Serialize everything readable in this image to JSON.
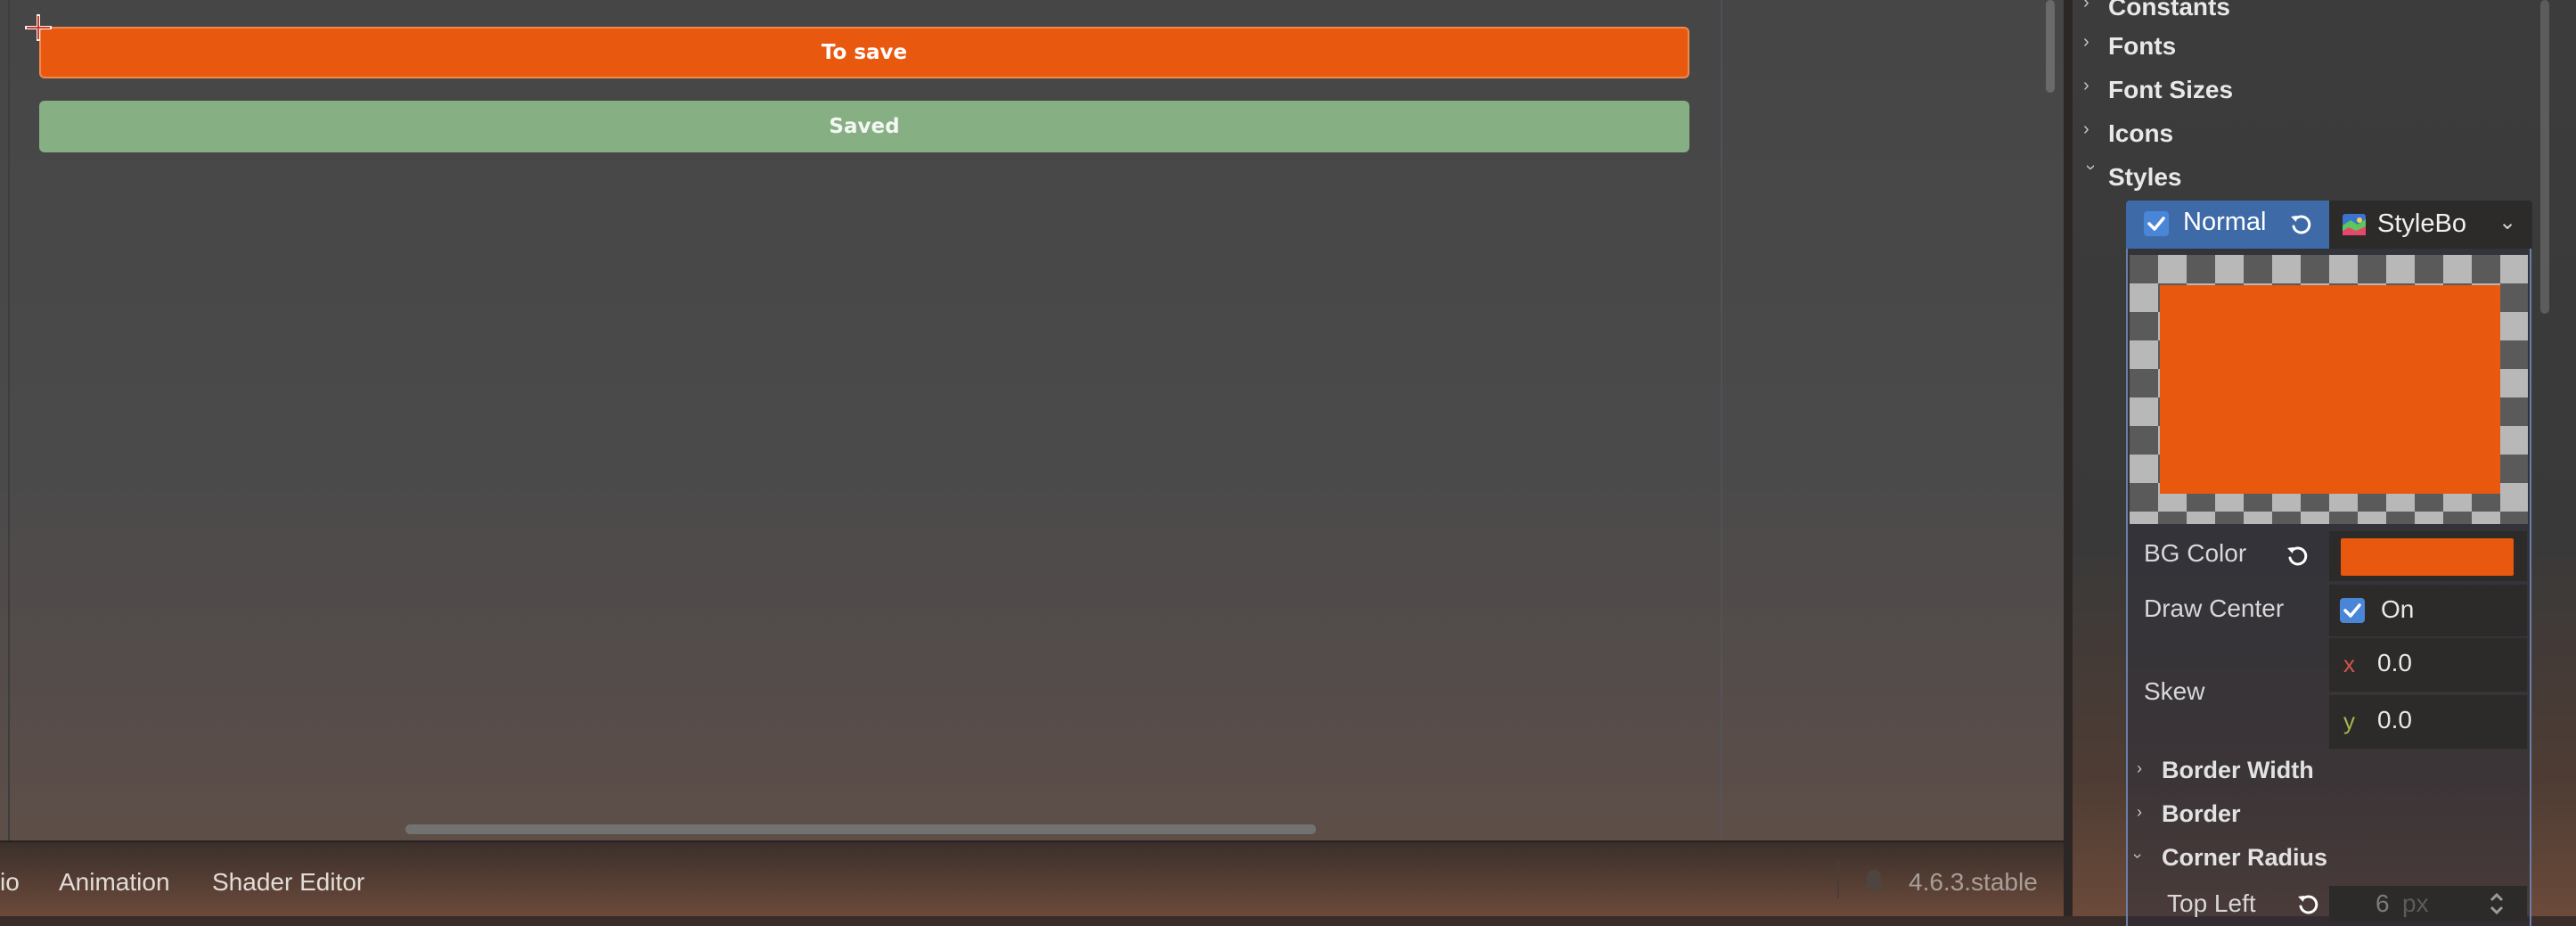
{
  "viewport": {
    "buttons": [
      {
        "label": "To save",
        "color": "#e8580f"
      },
      {
        "label": "Saved",
        "color": "#86b083"
      }
    ]
  },
  "bottom_bar": {
    "tabs": [
      "io",
      "Animation",
      "Shader Editor"
    ],
    "version": "4.6.3.stable",
    "notification_icon": "bell-icon"
  },
  "inspector": {
    "categories": [
      {
        "label": "Constants",
        "expanded": false
      },
      {
        "label": "Fonts",
        "expanded": false
      },
      {
        "label": "Font Sizes",
        "expanded": false
      },
      {
        "label": "Icons",
        "expanded": false
      },
      {
        "label": "Styles",
        "expanded": true
      }
    ],
    "normal": {
      "label": "Normal",
      "checked": true,
      "resource_type": "StyleBo",
      "resource_icon": "stylebox-icon"
    },
    "stylebox": {
      "preview_color": "#e8580f",
      "bg_color_label": "BG Color",
      "bg_color": "#e8580f",
      "draw_center_label": "Draw Center",
      "draw_center_value": "On",
      "skew_label": "Skew",
      "skew": {
        "x_axis": "x",
        "x": "0.0",
        "y_axis": "y",
        "y": "0.0"
      },
      "sections": [
        {
          "label": "Border Width",
          "expanded": false
        },
        {
          "label": "Border",
          "expanded": false
        },
        {
          "label": "Corner Radius",
          "expanded": true
        }
      ],
      "top_left_label": "Top Left",
      "top_left_value": "6",
      "top_left_unit": "px"
    }
  }
}
